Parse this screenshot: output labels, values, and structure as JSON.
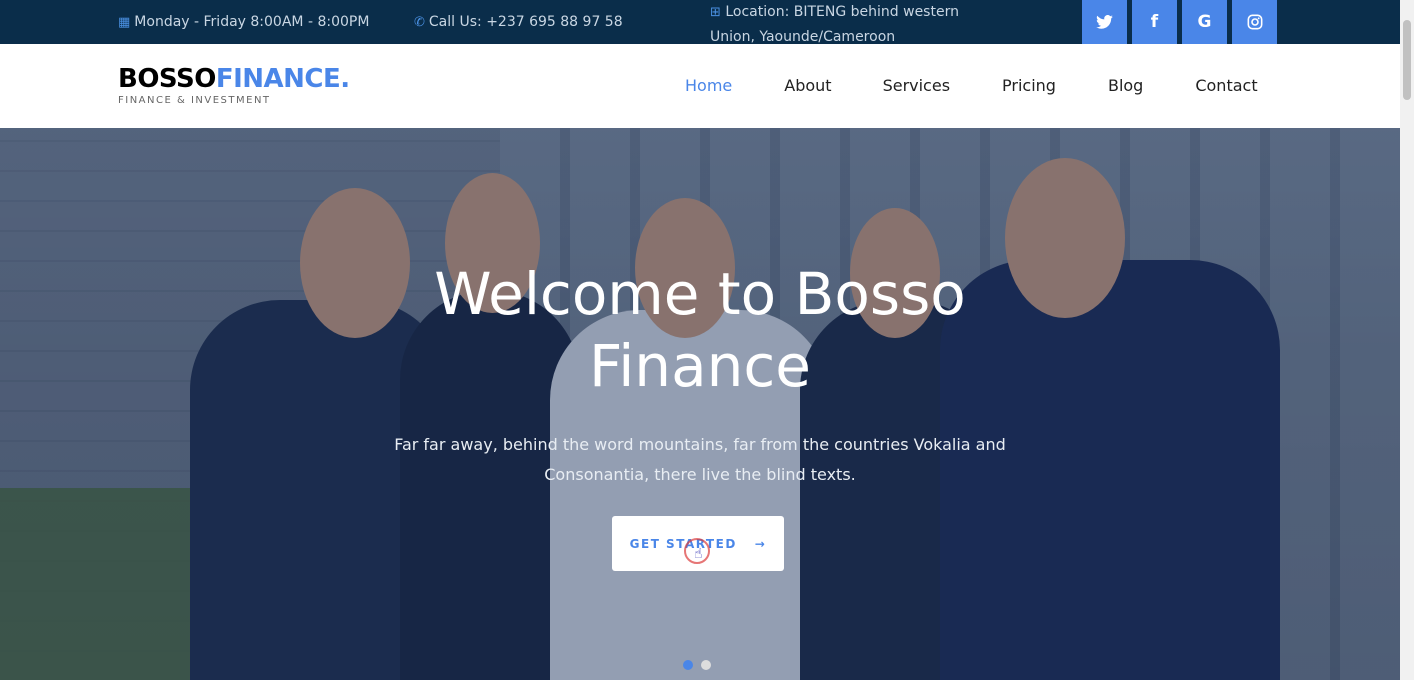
{
  "topbar": {
    "hours": "Monday - Friday 8:00AM - 8:00PM",
    "phone": "Call Us: +237 695 88 97 58",
    "location_line1": "Location: BITENG behind western",
    "location_line2": "Union, Yaounde/Cameroon",
    "social": [
      {
        "icon": "twitter-icon",
        "glyph": "🐦"
      },
      {
        "icon": "facebook-icon",
        "glyph": "f"
      },
      {
        "icon": "google-icon",
        "glyph": "G"
      },
      {
        "icon": "instagram-icon",
        "glyph": "◎"
      }
    ]
  },
  "logo": {
    "part1": "BOSSO",
    "part2": "FINANCE.",
    "tagline": "FINANCE & INVESTMENT"
  },
  "nav": {
    "items": [
      {
        "label": "Home",
        "active": true
      },
      {
        "label": "About"
      },
      {
        "label": "Services"
      },
      {
        "label": "Pricing"
      },
      {
        "label": "Blog"
      },
      {
        "label": "Contact"
      }
    ]
  },
  "hero": {
    "title": "Welcome to Bosso Finance",
    "subtitle": "Far far away, behind the word mountains, far from the countries Vokalia and Consonantia, there live the blind texts.",
    "cta_label": "GET STARTED",
    "cta_arrow": "→",
    "slides": [
      {
        "active": true
      },
      {
        "active": false
      }
    ]
  },
  "colors": {
    "accent": "#4a86e8",
    "topbar_bg": "#0a2d4a"
  }
}
